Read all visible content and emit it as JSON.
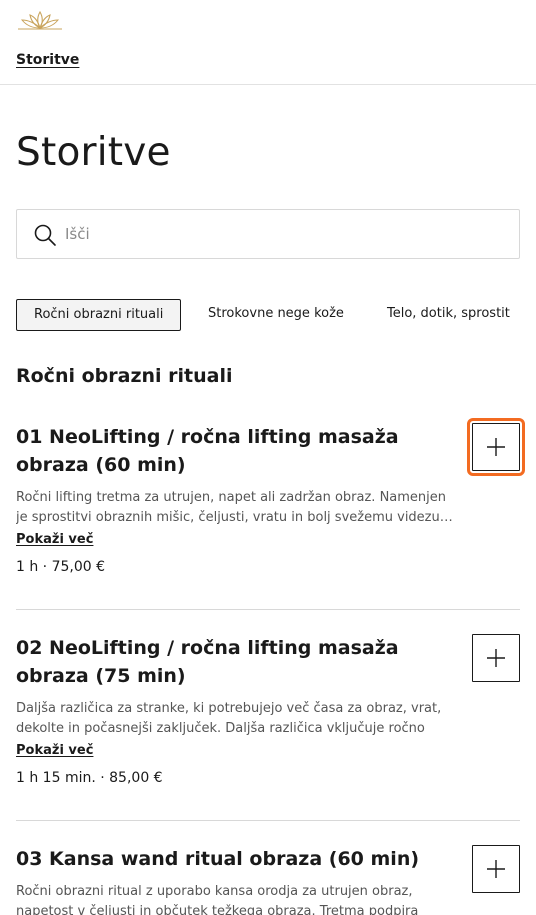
{
  "header": {
    "nav_label": "Storitve"
  },
  "page": {
    "title": "Storitve"
  },
  "search": {
    "placeholder": "Išči"
  },
  "tabs": [
    {
      "label": "Ročni obrazni rituali",
      "active": true
    },
    {
      "label": "Strokovne nege kože",
      "active": false
    },
    {
      "label": "Telo, dotik, sprostit",
      "active": false
    }
  ],
  "section": {
    "title": "Ročni obrazni rituali"
  },
  "services": [
    {
      "title": "01 NeoLifting / ročna lifting masaža obraza (60 min)",
      "description": "Ročni lifting tretma za utrujen, napet ali zadržan obraz. Namenjen je sprostitvi obraznih mišic, čeljusti, vratu in bolj svežemu videzu…",
      "more_label": "Pokaži več",
      "meta": "1 h · 75,00 €"
    },
    {
      "title": "02 NeoLifting / ročna lifting masaža obraza (75 min)",
      "description": "Daljša različica za stranke, ki potrebujejo več časa za obraz, vrat, dekolte in počasnejši zaključek. Daljša različica vključuje ročno del…",
      "more_label": "Pokaži več",
      "meta": "1 h 15 min. · 85,00 €"
    },
    {
      "title": "03 Kansa wand ritual obraza (60 min)",
      "description": "Ročni obrazni ritual z uporabo kansa orodja za utrujen obraz, napetost v čeljusti in občutek težkega obraza. Tretma podpira",
      "more_label": "",
      "meta": ""
    }
  ],
  "colors": {
    "focus_ring": "#f36b21",
    "text": "#1a1a1a",
    "muted_text": "#555555",
    "logo_gold": "#c9a45c"
  }
}
